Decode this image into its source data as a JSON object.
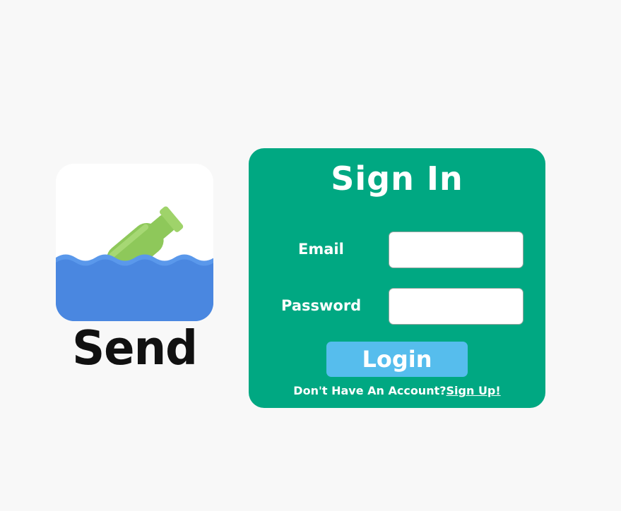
{
  "brand": {
    "name": "Send",
    "logo_icon": "message-in-a-bottle-icon"
  },
  "colors": {
    "page_background": "#f8f8f8",
    "panel": "#00a882",
    "login_button": "#56bded",
    "water": "#4a87e0",
    "bottle": "#8ec85a"
  },
  "signin": {
    "title": "Sign In",
    "email_label": "Email",
    "email_value": "",
    "password_label": "Password",
    "password_value": "",
    "login_label": "Login",
    "account_prompt": "Don't Have An Account?",
    "signup_link": "Sign Up!"
  }
}
